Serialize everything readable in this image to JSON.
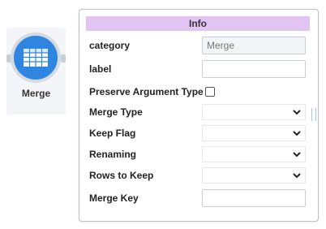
{
  "node": {
    "label": "Merge",
    "icon": "table-icon",
    "accent": "#2f86e0"
  },
  "panel": {
    "title": "Info",
    "header_color": "#e1c4f2",
    "fields": {
      "category": {
        "label": "category",
        "value": "Merge"
      },
      "label": {
        "label": "label",
        "value": ""
      },
      "preserve_argument_type": {
        "label": "Preserve Argument Type",
        "checked": false
      },
      "merge_type": {
        "label": "Merge Type",
        "value": ""
      },
      "keep_flag": {
        "label": "Keep Flag",
        "value": ""
      },
      "renaming": {
        "label": "Renaming",
        "value": ""
      },
      "rows_to_keep": {
        "label": "Rows to Keep",
        "value": ""
      },
      "merge_key": {
        "label": "Merge Key",
        "value": ""
      }
    }
  }
}
